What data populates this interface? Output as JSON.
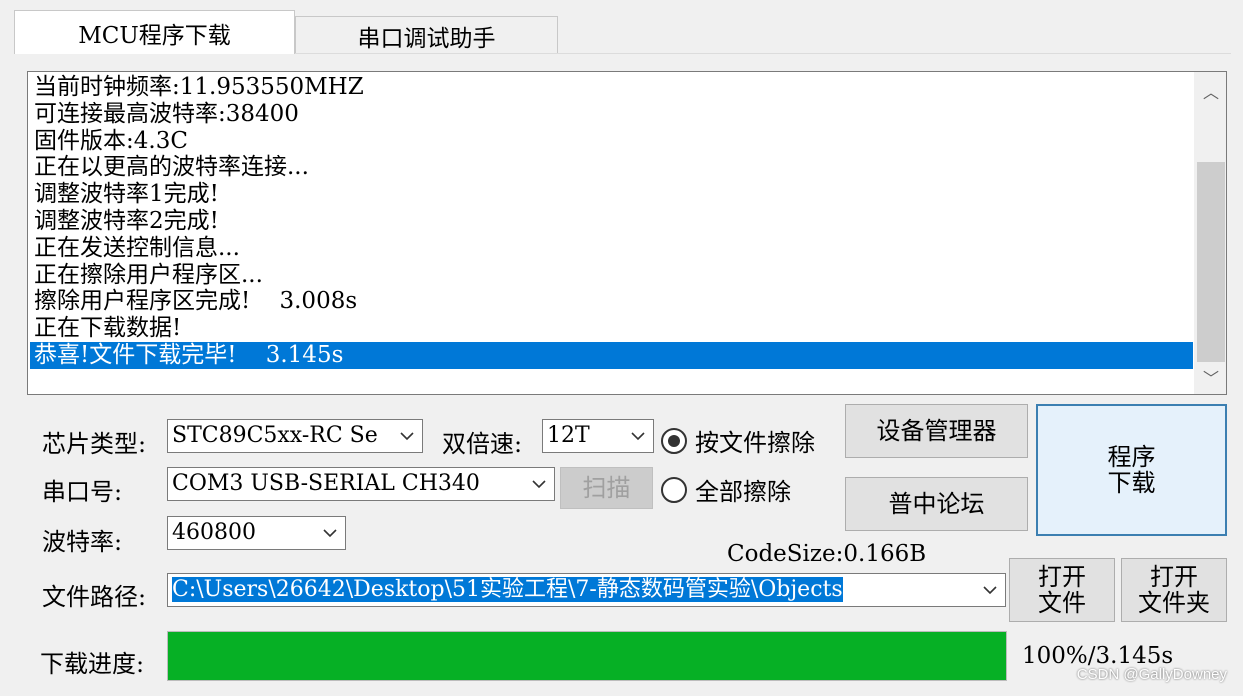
{
  "tabs": [
    {
      "label": "MCU程序下载",
      "active": true
    },
    {
      "label": "串口调试助手",
      "active": false
    }
  ],
  "log": {
    "lines": [
      "当前时钟频率:11.953550MHZ",
      "可连接最高波特率:38400",
      "固件版本:4.3C",
      "正在以更高的波特率连接...",
      "调整波特率1完成!",
      "调整波特率2完成!",
      "正在发送控制信息...",
      "正在擦除用户程序区...",
      "擦除用户程序区完成!    3.008s",
      "正在下载数据!",
      "恭喜!文件下载完毕!    3.145s"
    ],
    "selected_index": 10
  },
  "form": {
    "chip_label": "芯片类型:",
    "chip_value": "STC89C5xx-RC Se",
    "double_speed_label": "双倍速:",
    "double_speed_value": "12T",
    "port_label": "串口号:",
    "port_value": "COM3  USB-SERIAL CH340",
    "scan_label": "扫描",
    "baud_label": "波特率:",
    "baud_value": "460800",
    "path_label": "文件路径:",
    "path_value": "C:\\Users\\26642\\Desktop\\51实验工程\\7-静态数码管实验\\Objects",
    "progress_label": "下载进度:"
  },
  "erase_options": {
    "by_file": "按文件擦除",
    "all": "全部擦除",
    "selected": "by_file"
  },
  "buttons": {
    "device_manager": "设备管理器",
    "forum": "普中论坛",
    "program_line1": "程序",
    "program_line2": "下载",
    "open_file_line1": "打开",
    "open_file_line2": "文件",
    "open_folder_line1": "打开",
    "open_folder_line2": "文件夹"
  },
  "code_size": "CodeSize:0.166B",
  "progress": {
    "fraction": 1.0,
    "text": "100%/3.145s"
  },
  "watermark": "CSDN @GallyDowney",
  "colors": {
    "selection": "#0078d7",
    "progress_fill": "#06b025",
    "big_button_border": "#3c7fb1"
  }
}
